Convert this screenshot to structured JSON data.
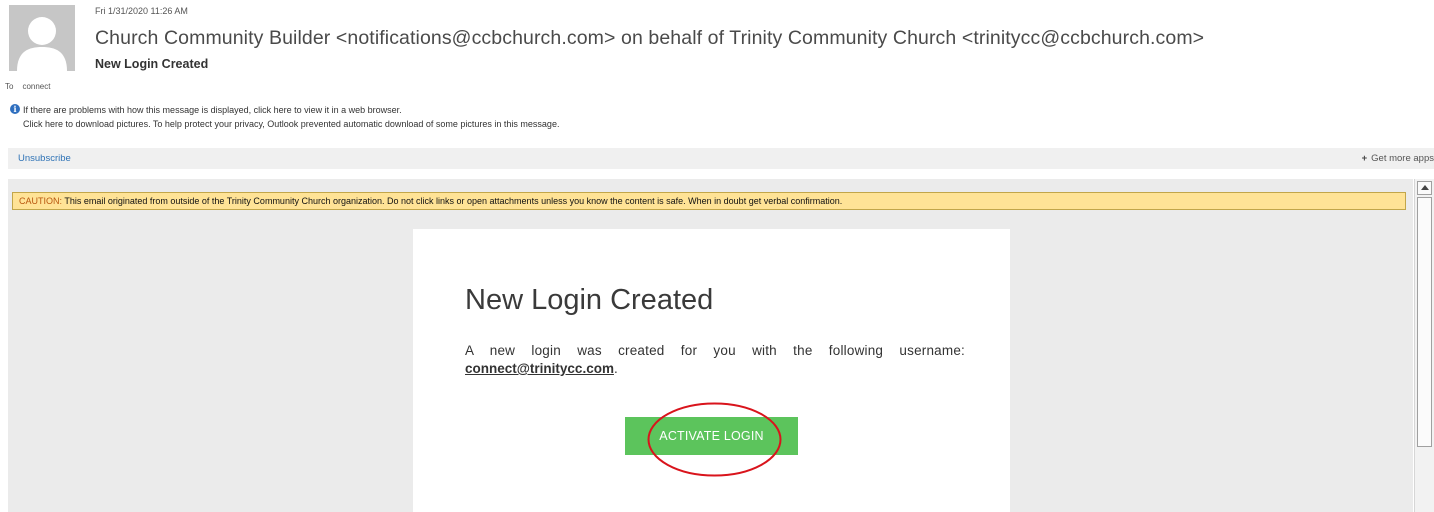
{
  "header": {
    "date": "Fri 1/31/2020 11:26 AM",
    "sender": "Church Community Builder <notifications@ccbchurch.com> on behalf of Trinity Community Church <trinitycc@ccbchurch.com>",
    "subject": "New Login Created",
    "to_label": "To",
    "to_value": "connect"
  },
  "info_bar": {
    "icon": "info-icon",
    "line1": "If there are problems with how this message is displayed, click here to view it in a web browser.",
    "line2": "Click here to download pictures. To help protect your privacy, Outlook prevented automatic download of some pictures in this message."
  },
  "apps_bar": {
    "unsubscribe": "Unsubscribe",
    "plus": "+",
    "get_more_apps": "Get more apps"
  },
  "caution": {
    "label": "CAUTION:",
    "text": " This email originated from outside of the Trinity Community Church organization. Do not click links or open attachments unless you know the content is safe. When in doubt get verbal confirmation."
  },
  "email_body": {
    "title": "New Login Created",
    "text_line1": "A new login was created for you with the following username:",
    "username": "connect@trinitycc.com",
    "period": ".",
    "button": "ACTIVATE LOGIN"
  },
  "colors": {
    "caution_bg": "#ffe396",
    "button_green": "#5cc45c",
    "link_blue": "#2f73b6",
    "annotation_red": "#d9141c"
  }
}
